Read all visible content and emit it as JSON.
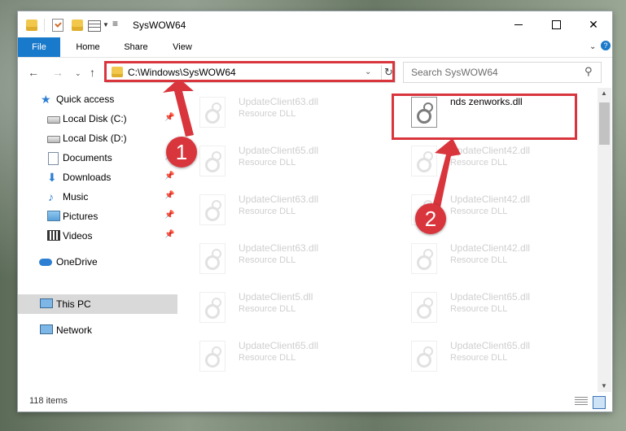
{
  "window": {
    "title": "SysWOW64",
    "controls": {
      "minimize_icon": "minimize-icon",
      "maximize_icon": "maximize-icon",
      "close_label": "✕"
    }
  },
  "ribbon": {
    "tabs": [
      {
        "label": "File",
        "active": true
      },
      {
        "label": "Home"
      },
      {
        "label": "Share"
      },
      {
        "label": "View"
      }
    ],
    "help_label": "?"
  },
  "nav": {
    "back_icon": "←",
    "forward_icon": "→",
    "recent_icon": "⌄",
    "up_icon": "↑",
    "address": "C:\\Windows\\SysWOW64",
    "address_dropdown": "⌄",
    "refresh_icon": "↻",
    "search_placeholder": "Search SysWOW64",
    "search_icon": "⚲"
  },
  "navpane": {
    "items": [
      {
        "label": "Quick access",
        "icon": "star-icon",
        "glyph": "★"
      },
      {
        "label": "Local Disk (C:)",
        "icon": "drive-icon",
        "pinned": true
      },
      {
        "label": "Local Disk (D:)",
        "icon": "drive-icon"
      },
      {
        "label": "Documents",
        "icon": "documents-icon",
        "pinned": true
      },
      {
        "label": "Downloads",
        "icon": "downloads-icon",
        "glyph": "⬇",
        "pinned": true
      },
      {
        "label": "Music",
        "icon": "music-icon",
        "glyph": "♪",
        "pinned": true
      },
      {
        "label": "Pictures",
        "icon": "pictures-icon",
        "pinned": true
      },
      {
        "label": "Videos",
        "icon": "videos-icon",
        "pinned": true
      },
      {
        "label": "OneDrive",
        "icon": "cloud-icon"
      },
      {
        "label": "This PC",
        "icon": "computer-icon",
        "selected": true
      },
      {
        "label": "Network",
        "icon": "network-icon"
      }
    ],
    "pin_glyph": "📌"
  },
  "files": {
    "left": [
      {
        "name": "UpdateClient63.dll",
        "type": "Resource DLL"
      },
      {
        "name": "UpdateClient65.dll",
        "type": "Resource DLL"
      },
      {
        "name": "UpdateClient63.dll",
        "type": "Resource DLL"
      },
      {
        "name": "UpdateClient63.dll",
        "type": "Resource DLL"
      },
      {
        "name": "UpdateClient5.dll",
        "type": "Resource DLL"
      },
      {
        "name": "UpdateClient65.dll",
        "type": "Resource DLL"
      }
    ],
    "right": [
      {
        "name": "nds zenworks.dll",
        "type": "",
        "highlight": true
      },
      {
        "name": "UpdateClient42.dll",
        "type": "Resource DLL"
      },
      {
        "name": "UpdateClient42.dll",
        "type": "Resource DLL"
      },
      {
        "name": "UpdateClient42.dll",
        "type": "Resource DLL"
      },
      {
        "name": "UpdateClient65.dll",
        "type": "Resource DLL"
      },
      {
        "name": "UpdateClient65.dll",
        "type": "Resource DLL"
      }
    ]
  },
  "status": {
    "items_count": "118 items"
  },
  "annotations": {
    "badge1": "1",
    "badge2": "2",
    "color": "#d9353d"
  },
  "colors": {
    "accent": "#1979ca",
    "selection": "#d9d9d9",
    "highlight": "#d9353d"
  }
}
